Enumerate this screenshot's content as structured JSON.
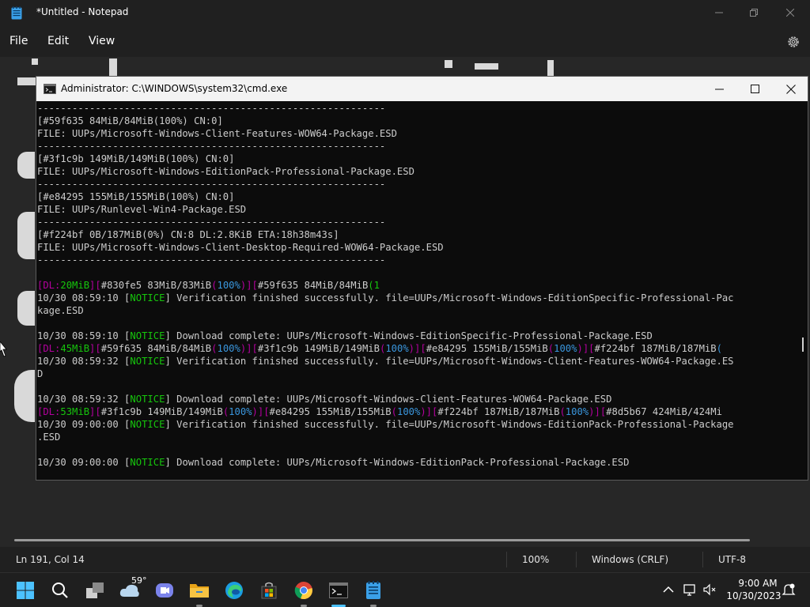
{
  "notepad": {
    "title": "*Untitled - Notepad",
    "menu": {
      "file": "File",
      "edit": "Edit",
      "view": "View"
    },
    "status": {
      "position": "Ln 191, Col 14",
      "zoom": "100%",
      "line_ending": "Windows (CRLF)",
      "encoding": "UTF-8"
    }
  },
  "cmd": {
    "title": "Administrator: C:\\WINDOWS\\system32\\cmd.exe",
    "lines": [
      [
        {
          "t": "------------------------------------------------------------"
        }
      ],
      [
        {
          "t": "[#59f635 84MiB/84MiB(100%) CN:0]"
        }
      ],
      [
        {
          "t": "FILE: UUPs/Microsoft-Windows-Client-Features-WOW64-Package.ESD"
        }
      ],
      [
        {
          "t": "------------------------------------------------------------"
        }
      ],
      [
        {
          "t": "[#3f1c9b 149MiB/149MiB(100%) CN:0]"
        }
      ],
      [
        {
          "t": "FILE: UUPs/Microsoft-Windows-EditionPack-Professional-Package.ESD"
        }
      ],
      [
        {
          "t": "------------------------------------------------------------"
        }
      ],
      [
        {
          "t": "[#e84295 155MiB/155MiB(100%) CN:0]"
        }
      ],
      [
        {
          "t": "FILE: UUPs/Runlevel-Win4-Package.ESD"
        }
      ],
      [
        {
          "t": "------------------------------------------------------------"
        }
      ],
      [
        {
          "t": "[#f224bf 0B/187MiB(0%) CN:8 DL:2.8KiB ETA:18h38m43s]"
        }
      ],
      [
        {
          "t": "FILE: UUPs/Microsoft-Windows-Client-Desktop-Required-WOW64-Package.ESD"
        }
      ],
      [
        {
          "t": "------------------------------------------------------------"
        }
      ],
      [
        {
          "t": ""
        }
      ],
      [
        {
          "t": "[",
          "c": "m"
        },
        {
          "t": "DL:",
          "c": "m"
        },
        {
          "t": "20MiB",
          "c": "g"
        },
        {
          "t": "][",
          "c": "m"
        },
        {
          "t": "#830fe5 83MiB/83MiB"
        },
        {
          "t": "(",
          "c": "m"
        },
        {
          "t": "100%",
          "c": "c"
        },
        {
          "t": ")][",
          "c": "m"
        },
        {
          "t": "#59f635 84MiB/84MiB"
        },
        {
          "t": "(1",
          "c": "g"
        }
      ],
      [
        {
          "t": "10/30 08:59:10 ["
        },
        {
          "t": "NOTICE",
          "c": "g"
        },
        {
          "t": "] Verification finished successfully. file=UUPs/Microsoft-Windows-EditionSpecific-Professional-Pac"
        }
      ],
      [
        {
          "t": "kage.ESD"
        }
      ],
      [
        {
          "t": ""
        }
      ],
      [
        {
          "t": "10/30 08:59:10 ["
        },
        {
          "t": "NOTICE",
          "c": "g"
        },
        {
          "t": "] Download complete: UUPs/Microsoft-Windows-EditionSpecific-Professional-Package.ESD"
        }
      ],
      [
        {
          "t": "[",
          "c": "m"
        },
        {
          "t": "DL:",
          "c": "m"
        },
        {
          "t": "45MiB",
          "c": "g"
        },
        {
          "t": "][",
          "c": "m"
        },
        {
          "t": "#59f635 84MiB/84MiB"
        },
        {
          "t": "(",
          "c": "m"
        },
        {
          "t": "100%",
          "c": "c"
        },
        {
          "t": ")][",
          "c": "m"
        },
        {
          "t": "#3f1c9b 149MiB/149MiB"
        },
        {
          "t": "(",
          "c": "m"
        },
        {
          "t": "100%",
          "c": "c"
        },
        {
          "t": ")][",
          "c": "m"
        },
        {
          "t": "#e84295 155MiB/155MiB"
        },
        {
          "t": "(",
          "c": "m"
        },
        {
          "t": "100%",
          "c": "c"
        },
        {
          "t": ")][",
          "c": "m"
        },
        {
          "t": "#f224bf 187MiB/187MiB"
        },
        {
          "t": "(",
          "c": "c"
        }
      ],
      [
        {
          "t": "10/30 08:59:32 ["
        },
        {
          "t": "NOTICE",
          "c": "g"
        },
        {
          "t": "] Verification finished successfully. file=UUPs/Microsoft-Windows-Client-Features-WOW64-Package.ES"
        }
      ],
      [
        {
          "t": "D"
        }
      ],
      [
        {
          "t": ""
        }
      ],
      [
        {
          "t": "10/30 08:59:32 ["
        },
        {
          "t": "NOTICE",
          "c": "g"
        },
        {
          "t": "] Download complete: UUPs/Microsoft-Windows-Client-Features-WOW64-Package.ESD"
        }
      ],
      [
        {
          "t": "[",
          "c": "m"
        },
        {
          "t": "DL:",
          "c": "m"
        },
        {
          "t": "53MiB",
          "c": "g"
        },
        {
          "t": "][",
          "c": "m"
        },
        {
          "t": "#3f1c9b 149MiB/149MiB"
        },
        {
          "t": "(",
          "c": "m"
        },
        {
          "t": "100%",
          "c": "c"
        },
        {
          "t": ")][",
          "c": "m"
        },
        {
          "t": "#e84295 155MiB/155MiB"
        },
        {
          "t": "(",
          "c": "m"
        },
        {
          "t": "100%",
          "c": "c"
        },
        {
          "t": ")][",
          "c": "m"
        },
        {
          "t": "#f224bf 187MiB/187MiB"
        },
        {
          "t": "(",
          "c": "m"
        },
        {
          "t": "100%",
          "c": "c"
        },
        {
          "t": ")][",
          "c": "m"
        },
        {
          "t": "#8d5b67 424MiB/424Mi"
        }
      ],
      [
        {
          "t": "10/30 09:00:00 ["
        },
        {
          "t": "NOTICE",
          "c": "g"
        },
        {
          "t": "] Verification finished successfully. file=UUPs/Microsoft-Windows-EditionPack-Professional-Package"
        }
      ],
      [
        {
          "t": ".ESD"
        }
      ],
      [
        {
          "t": ""
        }
      ],
      [
        {
          "t": "10/30 09:00:00 ["
        },
        {
          "t": "NOTICE",
          "c": "g"
        },
        {
          "t": "] Download complete: UUPs/Microsoft-Windows-EditionPack-Professional-Package.ESD"
        }
      ]
    ]
  },
  "taskbar": {
    "weather_temp": "59°",
    "clock_time": "9:00 AM",
    "clock_date": "10/30/2023",
    "icons": [
      "start-icon",
      "search-icon",
      "task-view-icon",
      "weather-icon",
      "teams-chat-icon",
      "file-explorer-icon",
      "edge-icon",
      "store-icon",
      "chrome-icon",
      "terminal-icon",
      "notepad-icon"
    ]
  },
  "colors": {
    "notice": "#16c60c",
    "bracket": "#b4009e",
    "percent": "#3a96dd",
    "console_text": "#cccccc",
    "console_bg": "#0c0c0c"
  }
}
